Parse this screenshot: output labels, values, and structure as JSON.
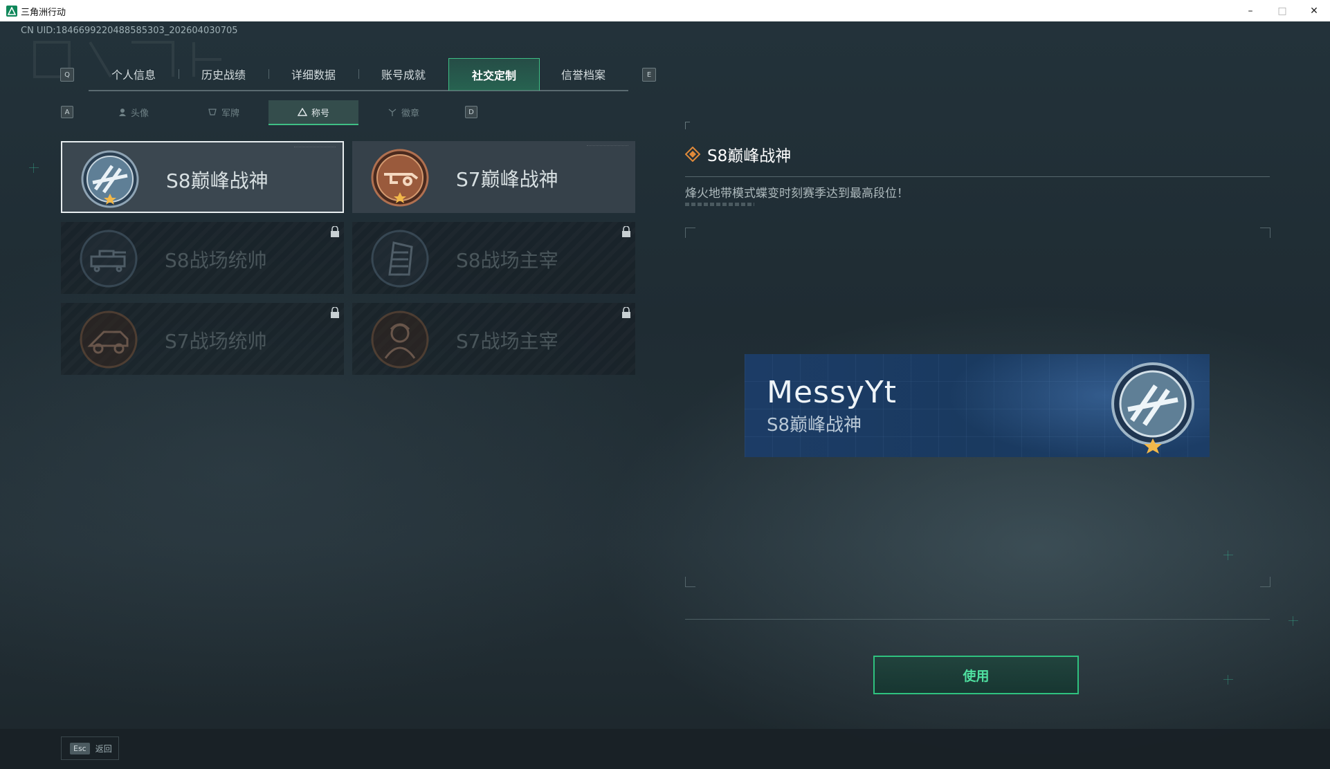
{
  "window": {
    "title": "三角洲行动",
    "minimize": "–",
    "maximize": "□",
    "close": "✕"
  },
  "header": {
    "uid": "CN UID:1846699220488585303_202604030705"
  },
  "main_tabs": {
    "prev_key": "Q",
    "next_key": "E",
    "items": [
      {
        "label": "个人信息",
        "active": false
      },
      {
        "label": "历史战绩",
        "active": false
      },
      {
        "label": "详细数据",
        "active": false
      },
      {
        "label": "账号成就",
        "active": false
      },
      {
        "label": "社交定制",
        "active": true
      },
      {
        "label": "信誉档案",
        "active": false
      }
    ]
  },
  "sub_tabs": {
    "prev_key": "A",
    "next_key": "D",
    "items": [
      {
        "label": "头像",
        "icon": "person-icon",
        "active": false
      },
      {
        "label": "军牌",
        "icon": "dogtag-icon",
        "active": false
      },
      {
        "label": "称号",
        "icon": "title-triangle-icon",
        "active": true
      },
      {
        "label": "徽章",
        "icon": "badge-icon",
        "active": false
      }
    ]
  },
  "titles": [
    {
      "label": "S8巅峰战神",
      "state": "selected",
      "badge": "s8-peak-badge-icon",
      "color": "#5f7f96"
    },
    {
      "label": "S7巅峰战神",
      "state": "unlocked",
      "badge": "s7-peak-badge-icon",
      "color": "#9a5a3c"
    },
    {
      "label": "S8战场统帅",
      "state": "locked",
      "badge": "s8-tank-badge-icon",
      "color": "#5a7184"
    },
    {
      "label": "S8战场主宰",
      "state": "locked",
      "badge": "s8-building-badge-icon",
      "color": "#5a7184"
    },
    {
      "label": "S7战场统帅",
      "state": "locked",
      "badge": "s7-vehicle-badge-icon",
      "color": "#8a5a3a"
    },
    {
      "label": "S7战场主宰",
      "state": "locked",
      "badge": "s7-soldier-badge-icon",
      "color": "#8a5a3a"
    }
  ],
  "detail": {
    "title": "S8巅峰战神",
    "description": "烽火地带模式蝶变时刻赛季达到最高段位！",
    "title_icon_color": "#e08a3a"
  },
  "preview": {
    "player_name": "MessyYt",
    "title": "S8巅峰战神"
  },
  "actions": {
    "use_label": "使用"
  },
  "footer": {
    "esc_key": "Esc",
    "esc_label": "返回"
  },
  "colors": {
    "accent": "#2fc27f",
    "accent_text": "#4fe0a0"
  }
}
